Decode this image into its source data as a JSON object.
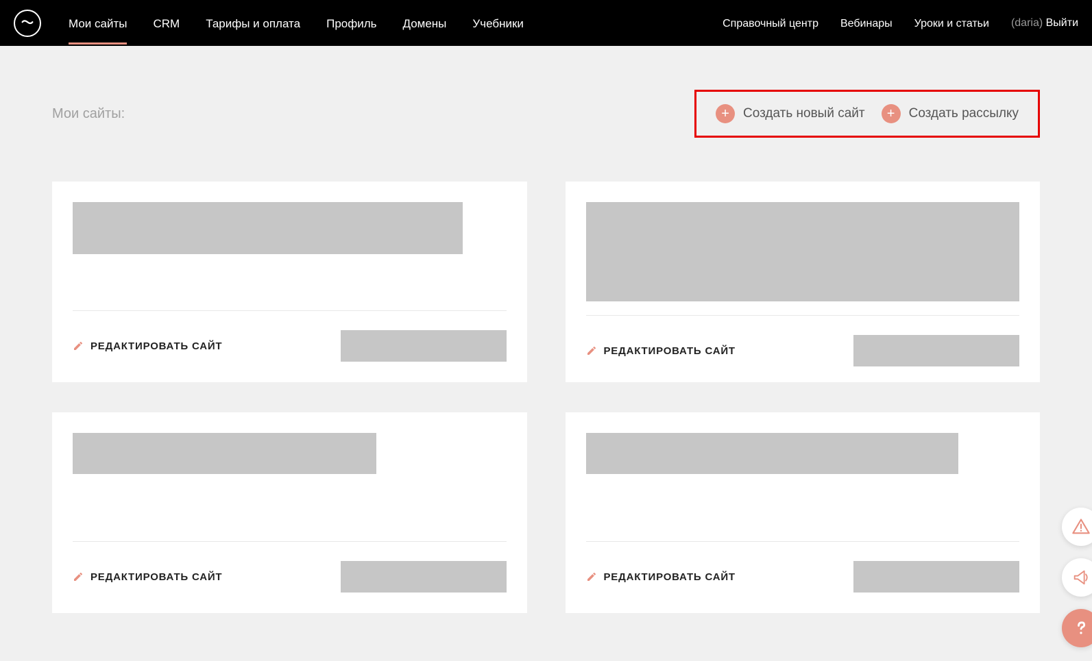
{
  "header": {
    "nav_main": [
      {
        "label": "Мои сайты",
        "active": true
      },
      {
        "label": "CRM",
        "active": false
      },
      {
        "label": "Тарифы и оплата",
        "active": false
      },
      {
        "label": "Профиль",
        "active": false
      },
      {
        "label": "Домены",
        "active": false
      },
      {
        "label": "Учебники",
        "active": false
      }
    ],
    "nav_right": [
      {
        "label": "Справочный центр"
      },
      {
        "label": "Вебинары"
      },
      {
        "label": "Уроки и статьи"
      }
    ],
    "user_name": "(daria)",
    "logout_label": "Выйти"
  },
  "page": {
    "title": "Мои сайты:"
  },
  "actions": {
    "create_site": "Создать новый сайт",
    "create_mailing": "Создать рассылку"
  },
  "cards": [
    {
      "edit_label": "РЕДАКТИРОВАТЬ САЙТ"
    },
    {
      "edit_label": "РЕДАКТИРОВАТЬ САЙТ"
    },
    {
      "edit_label": "РЕДАКТИРОВАТЬ САЙТ"
    },
    {
      "edit_label": "РЕДАКТИРОВАТЬ САЙТ"
    }
  ],
  "colors": {
    "accent": "#e89080",
    "highlight_border": "#e60000"
  }
}
